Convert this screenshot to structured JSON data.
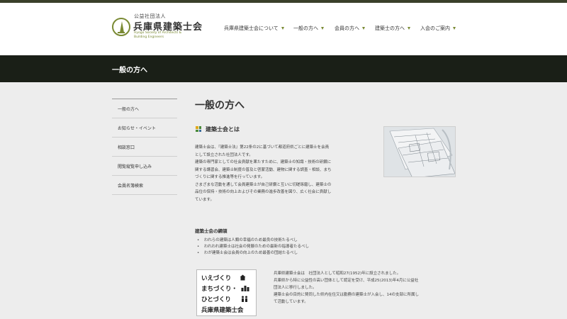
{
  "header": {
    "org_type": "公益社団法人",
    "org_name": "兵庫県建築士会",
    "org_name_en": "Hyogo Society of Architects & Building Engineers"
  },
  "nav": {
    "items": [
      {
        "label": "兵庫県建築士会について"
      },
      {
        "label": "一般の方へ"
      },
      {
        "label": "会員の方へ"
      },
      {
        "label": "建築士の方へ"
      },
      {
        "label": "入会のご案内"
      }
    ]
  },
  "band": {
    "title": "一般の方へ"
  },
  "sidebar": {
    "items": [
      {
        "label": "一般の方へ"
      },
      {
        "label": "お知らせ・イベント"
      },
      {
        "label": "相談窓口"
      },
      {
        "label": "閲覧縦覧申し込み"
      },
      {
        "label": "会員名簿検索"
      }
    ]
  },
  "main": {
    "page_title": "一般の方へ",
    "section_title": "建築士会とは",
    "body_lines": [
      "建築士会は、『建築士法』第22条の2に基づいて都道府県ごとに建築士を会員",
      "として設立された社団法人です。",
      "建築の専門家としての社会貢献を果たすために、建築士の知識・技術の研鑽に",
      "関する講習会、建築士制度の普及と啓蒙活動、建物に関する調査・相談、まち",
      "づくりに関する推進等を行っています。",
      "さまざまな活動を通して会員建築士が自己研鑽と互いに切磋琢磨し、建築士の",
      "品位の保持・技術の向上およびその業務の進歩改善を図り、広く社会に貢献し",
      "ています。"
    ],
    "principles_title": "建築士会の綱領",
    "principles": [
      "われらの建築は人類の幸福のため最良の技術たるべし",
      "われわれ建築士は社会の発展のための最新の指導者たるべし",
      "わが建築士会は会員の向上のため最善の団結たるべし"
    ],
    "card_lines": [
      "いえづくり",
      "まちづくり・",
      "ひとづくり",
      "兵庫県建築士会"
    ],
    "desc_lines": [
      "兵庫県建築士会は　社団法人として昭和27(1952)年に設立されました。",
      "兵庫県から特に公益性の高い団体として認定を受け、平成25(2013)年4月に公益社",
      "団法人に移行しました。",
      "建築士会の目的に賛同した県内在住又は勤務の建築士が入会し、14の支部に所属し",
      "て活動しています。"
    ]
  },
  "colors": {
    "accent": "#7a8a34",
    "band": "#1a1f17",
    "background": "#ededed"
  },
  "icons": {
    "logo": "tower-logo-icon",
    "section": "four-squares-icon",
    "nav_caret": "caret-down-icon",
    "card_icons": [
      "house-icon",
      "buildings-icon",
      "people-icon"
    ]
  }
}
